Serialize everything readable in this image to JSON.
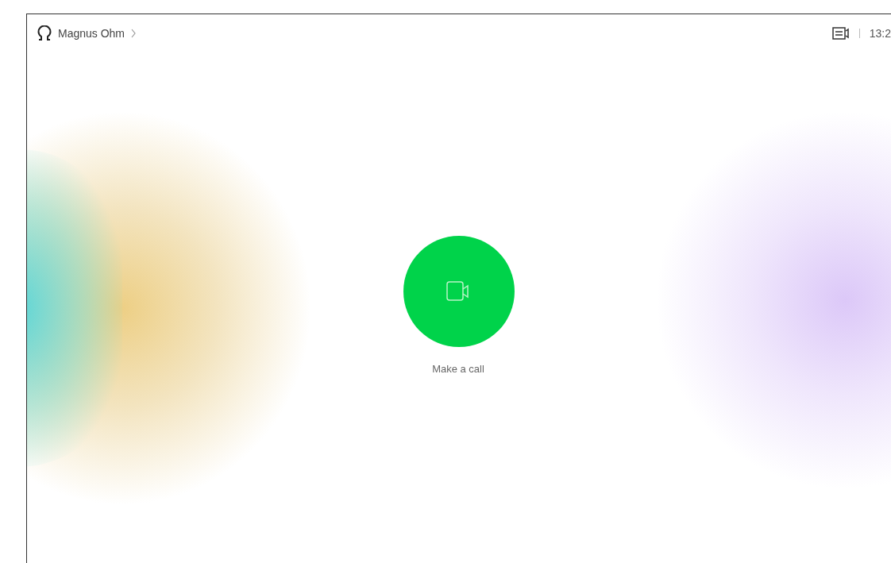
{
  "header": {
    "user_name": "Magnus Ohm",
    "time": "13:2"
  },
  "call_button": {
    "label": "Make a call"
  }
}
